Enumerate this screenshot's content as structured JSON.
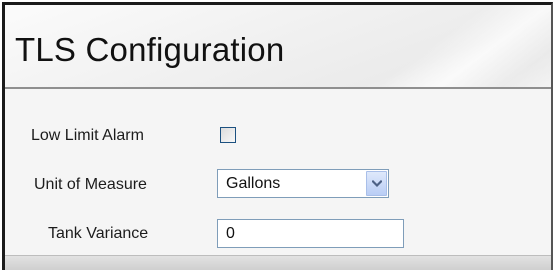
{
  "header": {
    "title": "TLS Configuration"
  },
  "form": {
    "low_limit_alarm": {
      "label": "Low Limit Alarm",
      "checked": false
    },
    "unit_of_measure": {
      "label": "Unit of Measure",
      "selected": "Gallons"
    },
    "tank_variance": {
      "label": "Tank Variance",
      "value": "0"
    }
  },
  "icons": {
    "dropdown": "chevron-down-icon"
  },
  "colors": {
    "field_border": "#7f9db9",
    "checkbox_border": "#1c5180",
    "dropdown_button": "#c8d8f7"
  }
}
